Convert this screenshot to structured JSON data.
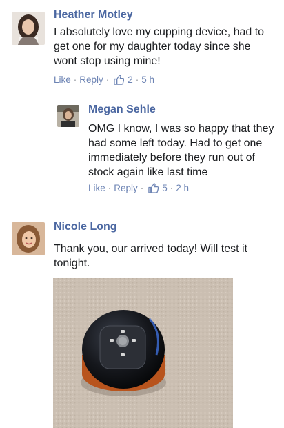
{
  "comments": [
    {
      "author": "Heather Motley",
      "text": "I absolutely love my cupping device, had to get one for my daughter today since she wont stop using mine!",
      "actions": {
        "like": "Like",
        "reply": "Reply",
        "likes": "2",
        "time": "5 h"
      }
    },
    {
      "author": "Megan Sehle",
      "text": "OMG I know, I was so happy that they had some left today. Had to get one immediately before they run out of stock again like last time",
      "actions": {
        "like": "Like",
        "reply": "Reply",
        "likes": "5",
        "time": "2 h"
      }
    },
    {
      "author": "Nicole Long",
      "text": "Thank you, our arrived today! Will test it tonight."
    }
  ],
  "icons": {
    "like": "thumbs-up-icon"
  },
  "colors": {
    "name": "#4b67a1",
    "link": "#6d84b4",
    "text": "#1c1e21"
  }
}
